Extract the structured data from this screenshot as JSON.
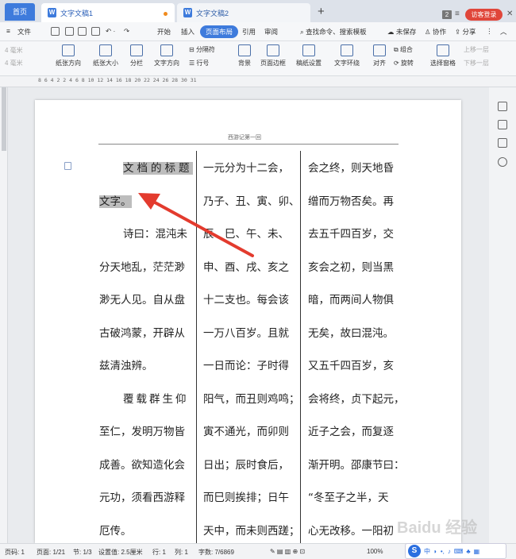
{
  "titlebar": {
    "home_tab": "首页",
    "tabs": [
      {
        "label": "文字文稿1",
        "active": true,
        "unsaved": true
      },
      {
        "label": "文字文稿2",
        "active": false,
        "unsaved": false
      }
    ],
    "window_count": "2",
    "visitor_login": "访客登录"
  },
  "menubar": {
    "file": "文件",
    "items": [
      "开始",
      "插入",
      "页面布局",
      "引用",
      "审阅"
    ],
    "active_item": "页面布局",
    "search": "查找命令、搜索模板",
    "unsaved": "未保存",
    "collaborate": "协作",
    "share": "分享"
  },
  "ribbon": {
    "margin_top": "4 毫米",
    "margin_bottom": "4 毫米",
    "orientation": "纸张方向",
    "size": "纸张大小",
    "columns": "分栏",
    "text_direction": "文字方向",
    "breaks": "分隔符",
    "line_numbers": "行号",
    "background": "背景",
    "page_border": "页面边框",
    "manuscript": "稿纸设置",
    "text_wrap": "文字环绕",
    "align": "对齐",
    "group": "组合",
    "rotate": "旋转",
    "selection_pane": "选择窗格",
    "move_up": "上移一层",
    "move_down": "下移一层"
  },
  "ruler": {
    "top_numbers": "8  6  4  2     2  4  6  8  10  12  14  16  18  20  22  24  26  28  30  31"
  },
  "document": {
    "header": "西游记第一回",
    "columns": [
      [
        "文档的标题",
        "文字。",
        "诗曰：混沌未",
        "分天地乱，茫茫渺",
        "渺无人见。自从盘",
        "古破鸿蒙，开辟从",
        "兹清浊辨。",
        "覆载群生仰",
        "至仁，发明万物皆",
        "成善。欲知造化会",
        "元功，须看西游释",
        "厄传。"
      ],
      [
        "一元分为十二会，",
        "乃子、丑、寅、卯、",
        "辰、巳、午、未、",
        "申、酉、戌、亥之",
        "十二支也。每会该",
        "一万八百岁。且就",
        "一日而论：子时得",
        "阳气，而丑则鸡鸣；",
        "寅不通光，而卯则",
        "日出；辰时食后，",
        "而巳则挨排；日午",
        "天中，而未则西蹉；"
      ],
      [
        "会之终，则天地昏",
        "缯而万物否矣。再",
        "去五千四百岁，交",
        "亥会之初，则当黑",
        "暗，而两间人物俱",
        "无矣，故曰混沌。",
        "又五千四百岁，亥",
        "会将终，贞下起元，",
        "近子之会，而复逐",
        "渐开明。邵康节曰：",
        "“冬至子之半，天",
        "心无改移。一阳初"
      ]
    ]
  },
  "statusbar": {
    "page": "页码: 1",
    "pages": "页面: 1/21",
    "section": "节: 1/3",
    "setting": "设置值: 2.5厘米",
    "row": "行: 1",
    "col": "列: 1",
    "wordcount": "字数: 7/6869",
    "zoom": "100%"
  },
  "ime": {
    "label": "中"
  },
  "watermark": "Baidu 经验",
  "colors": {
    "accent": "#3e7bdc",
    "arrow": "#e33b2e",
    "visitor": "#e0463a"
  }
}
